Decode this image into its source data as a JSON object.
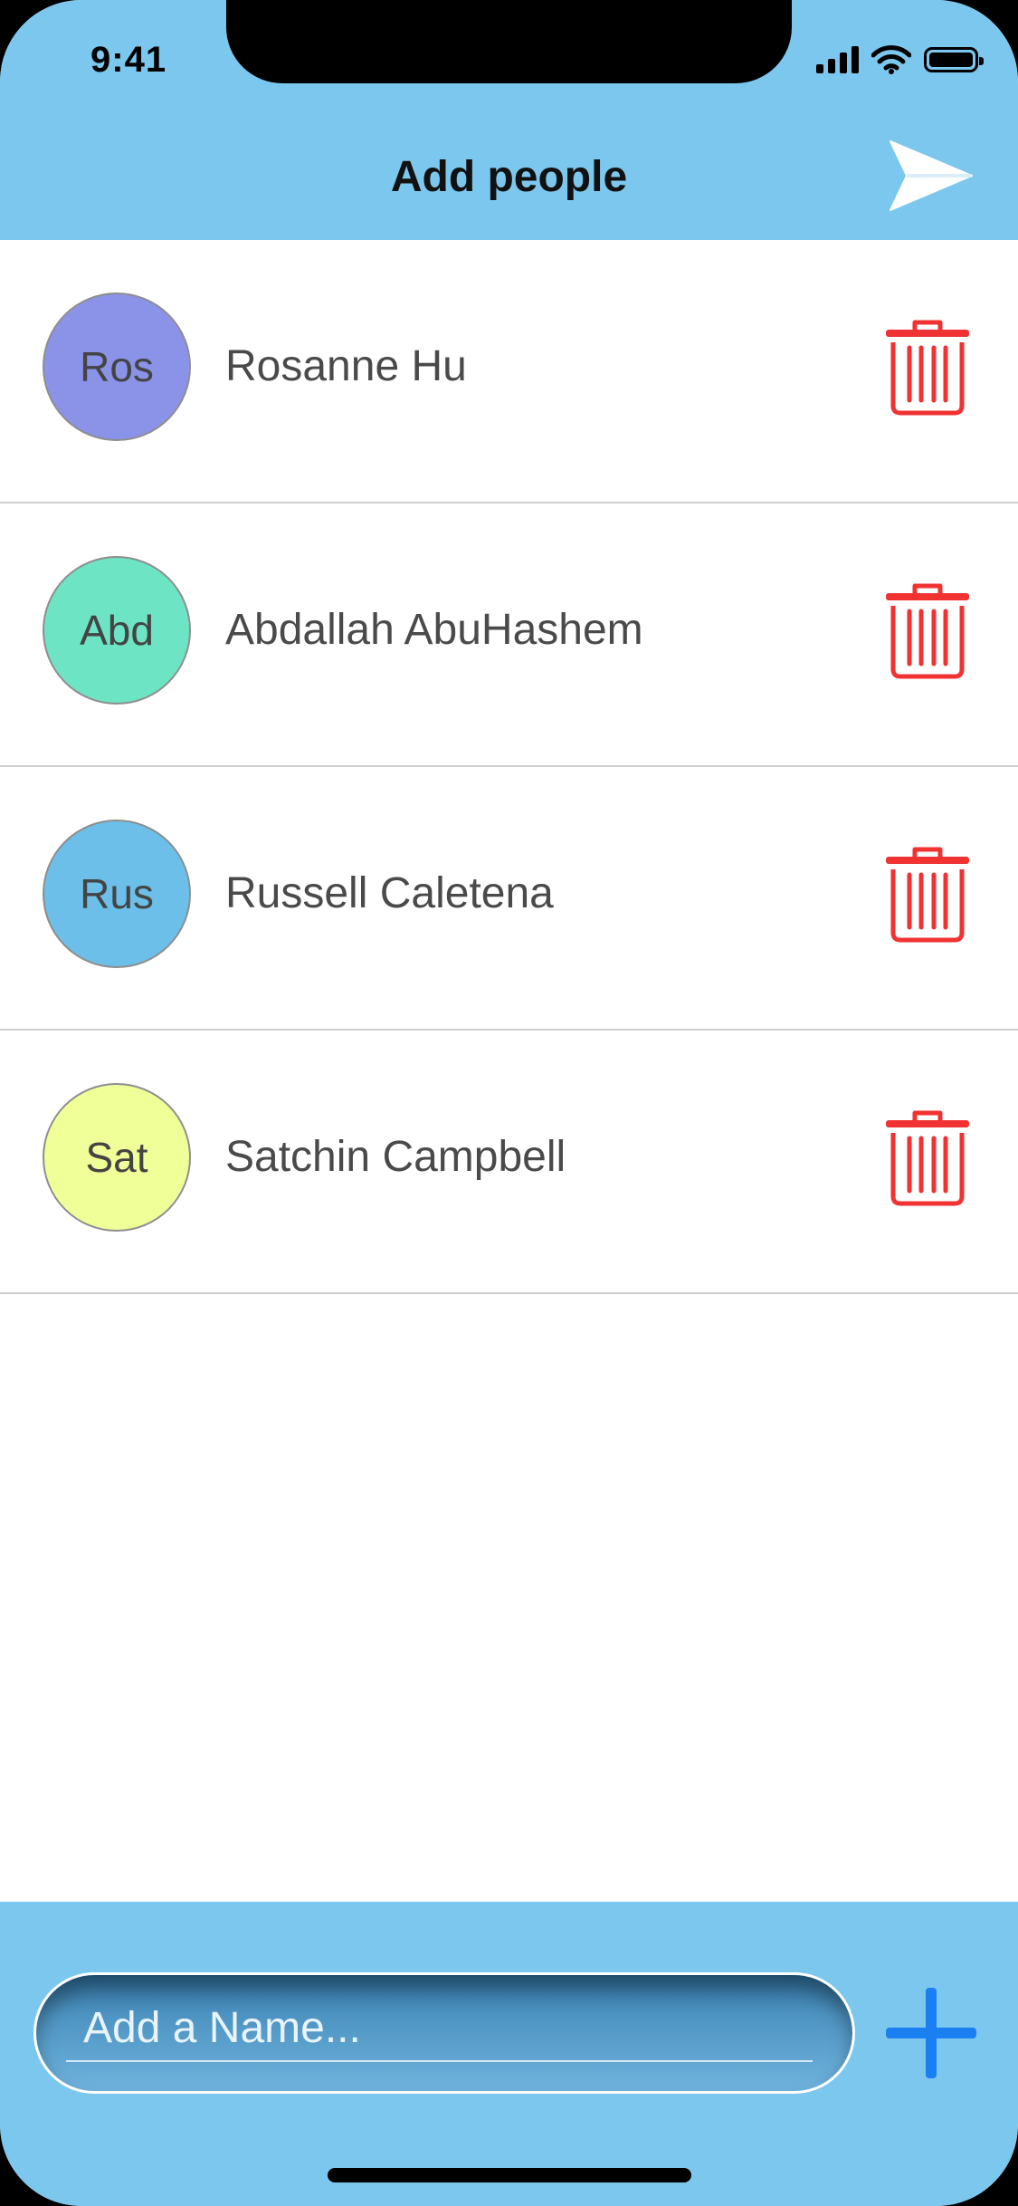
{
  "status": {
    "time": "9:41"
  },
  "header": {
    "title": "Add people"
  },
  "people": [
    {
      "initials": "Ros",
      "name": "Rosanne Hu",
      "color": "#8a93e8"
    },
    {
      "initials": "Abd",
      "name": "Abdallah AbuHashem",
      "color": "#6de4c3"
    },
    {
      "initials": "Rus",
      "name": "Russell Caletena",
      "color": "#6bbfe8"
    },
    {
      "initials": "Sat",
      "name": "Satchin Campbell",
      "color": "#f0ff98"
    }
  ],
  "composer": {
    "placeholder": "Add a Name..."
  },
  "colors": {
    "bar": "#7cc7ed",
    "delete": "#f03232",
    "add": "#1a7ff0"
  },
  "icons": {
    "send": "send-icon",
    "delete": "trash-icon",
    "add": "plus-icon"
  }
}
